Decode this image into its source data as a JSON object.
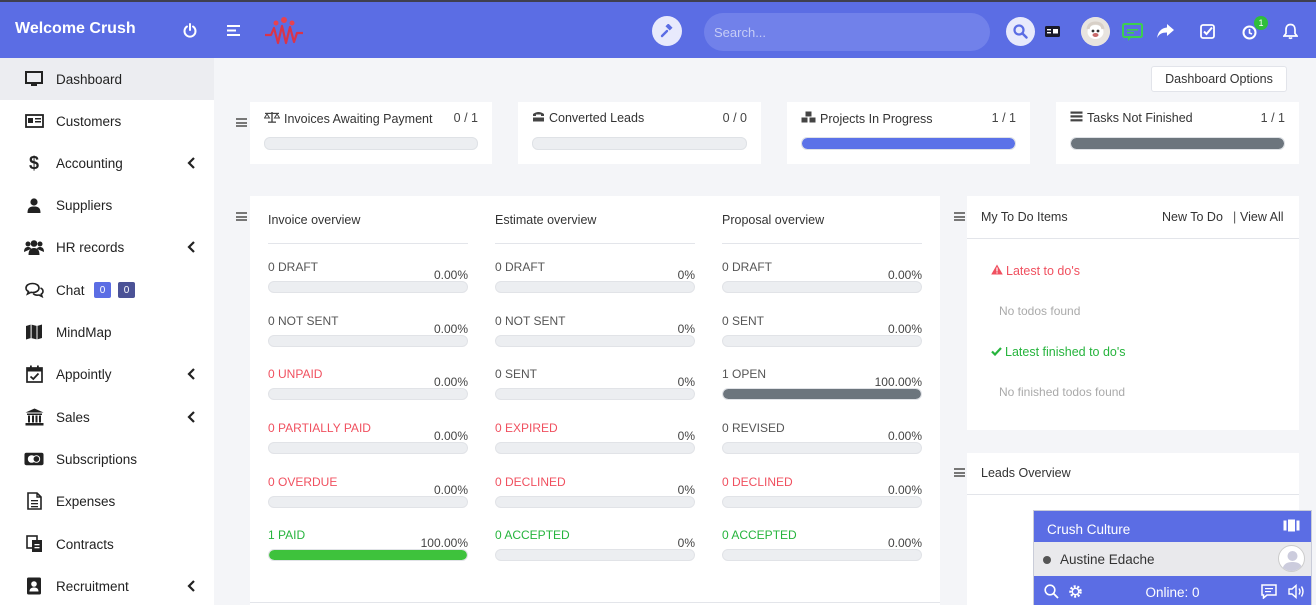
{
  "brand": "Welcome Crush",
  "search": {
    "placeholder": "Search..."
  },
  "notifications": {
    "timer_badge": "1"
  },
  "sidebar": {
    "items": [
      {
        "label": "Dashboard",
        "icon": "monitor-icon"
      },
      {
        "label": "Customers",
        "icon": "id-card-icon"
      },
      {
        "label": "Accounting",
        "icon": "dollar-icon"
      },
      {
        "label": "Suppliers",
        "icon": "user-icon"
      },
      {
        "label": "HR records",
        "icon": "users-icon"
      },
      {
        "label": "Chat",
        "icon": "comments-icon",
        "badges": [
          "0",
          "0"
        ]
      },
      {
        "label": "MindMap",
        "icon": "map-icon"
      },
      {
        "label": "Appointly",
        "icon": "calendar-check-icon"
      },
      {
        "label": "Sales",
        "icon": "bank-icon"
      },
      {
        "label": "Subscriptions",
        "icon": "cc-icon"
      },
      {
        "label": "Expenses",
        "icon": "file-icon"
      },
      {
        "label": "Contracts",
        "icon": "contract-icon"
      },
      {
        "label": "Recruitment",
        "icon": "address-book-icon"
      }
    ]
  },
  "dashboard_options": "Dashboard Options",
  "stats": [
    {
      "title": "Invoices Awaiting Payment",
      "value": "0 / 1",
      "progress": 0,
      "color": "#5b6de4"
    },
    {
      "title": "Converted Leads",
      "value": "0 / 0",
      "progress": 0,
      "color": "#5b6de4"
    },
    {
      "title": "Projects In Progress",
      "value": "1 / 1",
      "progress": 1,
      "color": "#5b72e8"
    },
    {
      "title": "Tasks Not Finished",
      "value": "1 / 1",
      "progress": 1,
      "color": "#6c757d"
    }
  ],
  "overview": {
    "invoice": {
      "title": "Invoice overview",
      "rows": [
        {
          "label": "0 DRAFT",
          "pct": "0.00%",
          "progress": 0,
          "color": "#555"
        },
        {
          "label": "0 NOT SENT",
          "pct": "0.00%",
          "progress": 0,
          "color": "#555"
        },
        {
          "label": "0 UNPAID",
          "pct": "0.00%",
          "progress": 0,
          "color": "#f0505f"
        },
        {
          "label": "0 PARTIALLY PAID",
          "pct": "0.00%",
          "progress": 0,
          "color": "#f0505f"
        },
        {
          "label": "0 OVERDUE",
          "pct": "0.00%",
          "progress": 0,
          "color": "#f0505f"
        },
        {
          "label": "1 PAID",
          "pct": "100.00%",
          "progress": 1,
          "color": "#26b43d",
          "fill": "#3ec23c"
        }
      ]
    },
    "estimate": {
      "title": "Estimate overview",
      "rows": [
        {
          "label": "0 DRAFT",
          "pct": "0%",
          "progress": 0,
          "color": "#555"
        },
        {
          "label": "0 NOT SENT",
          "pct": "0%",
          "progress": 0,
          "color": "#555"
        },
        {
          "label": "0 SENT",
          "pct": "0%",
          "progress": 0,
          "color": "#555"
        },
        {
          "label": "0 EXPIRED",
          "pct": "0%",
          "progress": 0,
          "color": "#f0505f"
        },
        {
          "label": "0 DECLINED",
          "pct": "0%",
          "progress": 0,
          "color": "#f0505f"
        },
        {
          "label": "0 ACCEPTED",
          "pct": "0%",
          "progress": 0,
          "color": "#26b43d"
        }
      ]
    },
    "proposal": {
      "title": "Proposal overview",
      "rows": [
        {
          "label": "0 DRAFT",
          "pct": "0.00%",
          "progress": 0,
          "color": "#555"
        },
        {
          "label": "0 SENT",
          "pct": "0.00%",
          "progress": 0,
          "color": "#555"
        },
        {
          "label": "1 OPEN",
          "pct": "100.00%",
          "progress": 1,
          "color": "#555",
          "fill": "#6c757d"
        },
        {
          "label": "0 REVISED",
          "pct": "0.00%",
          "progress": 0,
          "color": "#555"
        },
        {
          "label": "0 DECLINED",
          "pct": "0.00%",
          "progress": 0,
          "color": "#f0505f"
        },
        {
          "label": "0 ACCEPTED",
          "pct": "0.00%",
          "progress": 0,
          "color": "#26b43d"
        }
      ]
    }
  },
  "todo": {
    "title": "My To Do Items",
    "new_link": "New To Do",
    "separator": "|",
    "view_all": "View All",
    "latest": "Latest to do's",
    "no_todos": "No todos found",
    "latest_finished": "Latest finished to do's",
    "no_finished": "No finished todos found"
  },
  "leads": {
    "title": "Leads Overview"
  },
  "chat_widget": {
    "title": "Crush Culture",
    "user": "Austine Edache",
    "online": "Online: 0"
  }
}
